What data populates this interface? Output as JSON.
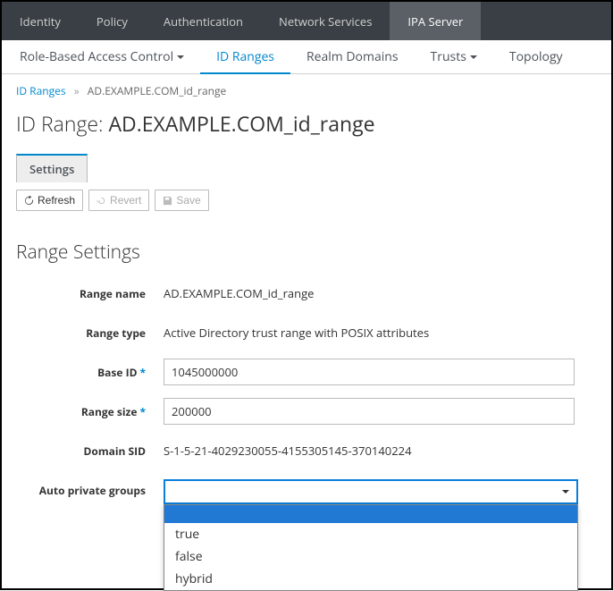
{
  "topnav": {
    "items": [
      {
        "label": "Identity"
      },
      {
        "label": "Policy"
      },
      {
        "label": "Authentication"
      },
      {
        "label": "Network Services"
      },
      {
        "label": "IPA Server"
      }
    ],
    "active_index": 4
  },
  "subnav": {
    "items": [
      {
        "label": "Role-Based Access Control",
        "caret": true
      },
      {
        "label": "ID Ranges"
      },
      {
        "label": "Realm Domains"
      },
      {
        "label": "Trusts",
        "caret": true
      },
      {
        "label": "Topology"
      }
    ],
    "active_index": 1
  },
  "breadcrumb": {
    "link": "ID Ranges",
    "separator": "»",
    "current": "AD.EXAMPLE.COM_id_range"
  },
  "page": {
    "title_prefix": "ID Range: ",
    "title_name": "AD.EXAMPLE.COM_id_range"
  },
  "tabs": {
    "settings": "Settings"
  },
  "toolbar": {
    "refresh": "Refresh",
    "revert": "Revert",
    "save": "Save"
  },
  "section": {
    "title": "Range Settings"
  },
  "form": {
    "range_name": {
      "label": "Range name",
      "value": "AD.EXAMPLE.COM_id_range"
    },
    "range_type": {
      "label": "Range type",
      "value": "Active Directory trust range with POSIX attributes"
    },
    "base_id": {
      "label": "Base ID",
      "value": "1045000000",
      "required": true
    },
    "range_size": {
      "label": "Range size",
      "value": "200000",
      "required": true
    },
    "domain_sid": {
      "label": "Domain SID",
      "value": "S-1-5-21-4029230055-4155305145-370140224"
    },
    "auto_private_groups": {
      "label": "Auto private groups",
      "selected": "",
      "options": [
        "",
        "true",
        "false",
        "hybrid"
      ]
    }
  }
}
